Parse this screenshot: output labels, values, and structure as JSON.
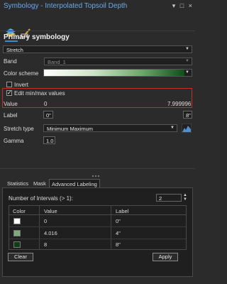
{
  "window": {
    "title": "Symbology - Interpolated Topsoil Depth",
    "controls": [
      "▾",
      "□",
      "×"
    ],
    "tabs": [
      {
        "name": "primary-symbology-tab",
        "icon": "raster-layer-icon",
        "active": true
      },
      {
        "name": "edit-tab",
        "icon": "pencil-icon",
        "active": false
      }
    ]
  },
  "primary": {
    "heading": "Primary symbology",
    "renderer": "Stretch",
    "band_label": "Band",
    "band_value": "Band_1",
    "color_scheme_label": "Color scheme",
    "invert_label": "Invert",
    "invert_checked": false,
    "edit_minmax_label": "Edit min/max values",
    "edit_minmax_checked": true,
    "value_label": "Value",
    "value_min": "0",
    "value_max": "7.999996",
    "label_label": "Label",
    "label_min": "0\"",
    "label_max": "8\"",
    "stretch_type_label": "Stretch type",
    "stretch_type": "Minimum Maximum",
    "gamma_label": "Gamma",
    "gamma": "1.0"
  },
  "lower": {
    "tabs": [
      "Statistics",
      "Mask",
      "Advanced Labeling"
    ],
    "active_tab": "Advanced Labeling",
    "intervals_label": "Number of Intervals (> 1):",
    "intervals_value": "2",
    "columns": [
      "Color",
      "Value",
      "Label"
    ],
    "rows": [
      {
        "color": "#ffffff",
        "value": "0",
        "label": "0\""
      },
      {
        "color": "#7fa87f",
        "value": "4.016",
        "label": "4\""
      },
      {
        "color": "#0f3d18",
        "value": "8",
        "label": "8\""
      }
    ],
    "clear_label": "Clear",
    "apply_label": "Apply"
  },
  "colors": {
    "accent": "#2f8fd8",
    "highlight_border": "#c0312b",
    "title_text": "#6aa9e8"
  }
}
